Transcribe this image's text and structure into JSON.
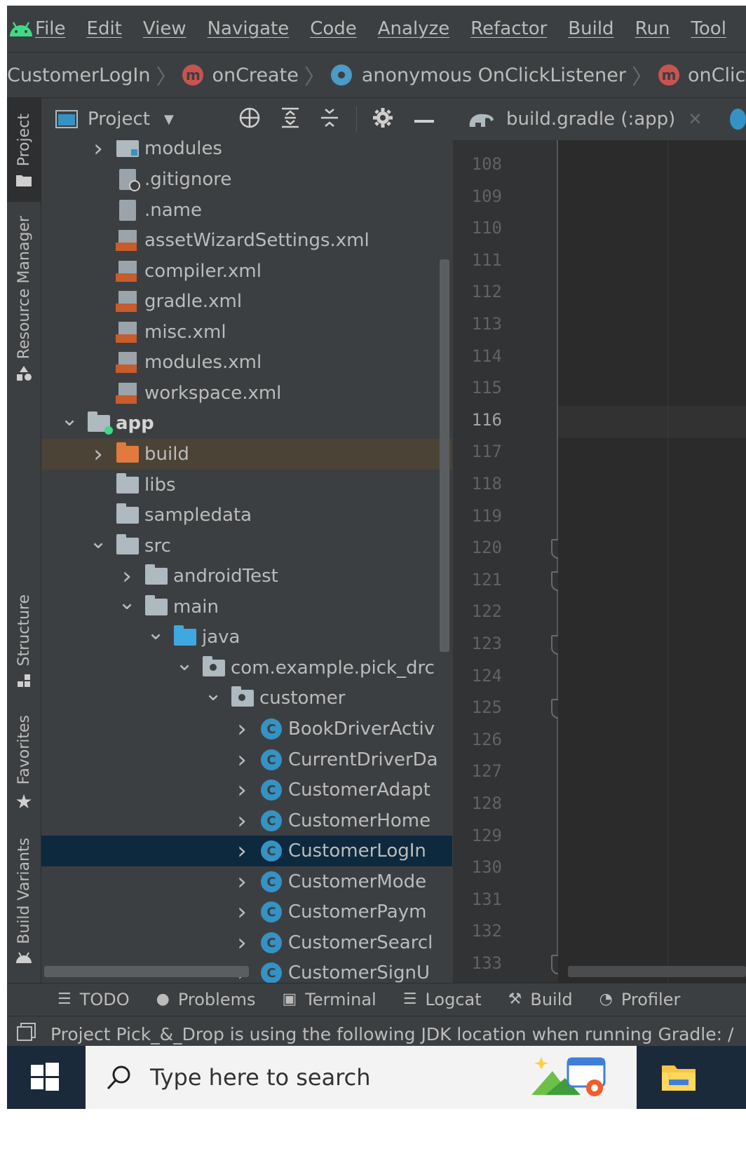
{
  "menu": [
    "File",
    "Edit",
    "View",
    "Navigate",
    "Code",
    "Analyze",
    "Refactor",
    "Build",
    "Run",
    "Tool"
  ],
  "breadcrumb": {
    "items": [
      {
        "label": "CustomerLogIn",
        "icon": ""
      },
      {
        "label": "onCreate",
        "icon": "method-icon"
      },
      {
        "label": "anonymous OnClickListener",
        "icon": "lambda-icon"
      },
      {
        "label": "onClick",
        "icon": "method-icon"
      }
    ]
  },
  "side_stripe": [
    "Project",
    "Resource Manager",
    "Structure",
    "Favorites",
    "Build Variants"
  ],
  "project_panel": {
    "title": "Project",
    "tree": [
      {
        "label": "modules",
        "depth": 2,
        "arrow": "right",
        "icon": "folder-modules"
      },
      {
        "label": ".gitignore",
        "depth": 2,
        "arrow": "",
        "icon": "gitignore"
      },
      {
        "label": ".name",
        "depth": 2,
        "arrow": "",
        "icon": "text"
      },
      {
        "label": "assetWizardSettings.xml",
        "depth": 2,
        "arrow": "",
        "icon": "xml"
      },
      {
        "label": "compiler.xml",
        "depth": 2,
        "arrow": "",
        "icon": "xml"
      },
      {
        "label": "gradle.xml",
        "depth": 2,
        "arrow": "",
        "icon": "xml"
      },
      {
        "label": "misc.xml",
        "depth": 2,
        "arrow": "",
        "icon": "xml"
      },
      {
        "label": "modules.xml",
        "depth": 2,
        "arrow": "",
        "icon": "xml"
      },
      {
        "label": "workspace.xml",
        "depth": 2,
        "arrow": "",
        "icon": "xml"
      },
      {
        "label": "app",
        "depth": 1,
        "arrow": "down",
        "icon": "folder-module",
        "bold": true
      },
      {
        "label": "build",
        "depth": 2,
        "arrow": "right",
        "icon": "folder-orange",
        "highlight": "dim"
      },
      {
        "label": "libs",
        "depth": 2,
        "arrow": "",
        "icon": "folder"
      },
      {
        "label": "sampledata",
        "depth": 2,
        "arrow": "",
        "icon": "folder"
      },
      {
        "label": "src",
        "depth": 2,
        "arrow": "down",
        "icon": "folder"
      },
      {
        "label": "androidTest",
        "depth": 3,
        "arrow": "right",
        "icon": "folder"
      },
      {
        "label": "main",
        "depth": 3,
        "arrow": "down",
        "icon": "folder"
      },
      {
        "label": "java",
        "depth": 4,
        "arrow": "down",
        "icon": "folder-blue"
      },
      {
        "label": "com.example.pick_drc",
        "depth": 5,
        "arrow": "down",
        "icon": "package"
      },
      {
        "label": "customer",
        "depth": 6,
        "arrow": "down",
        "icon": "package"
      },
      {
        "label": "BookDriverActiv",
        "depth": 7,
        "arrow": "right",
        "icon": "class"
      },
      {
        "label": "CurrentDriverDa",
        "depth": 7,
        "arrow": "right",
        "icon": "class"
      },
      {
        "label": "CustomerAdapt",
        "depth": 7,
        "arrow": "right",
        "icon": "class"
      },
      {
        "label": "CustomerHome",
        "depth": 7,
        "arrow": "right",
        "icon": "class"
      },
      {
        "label": "CustomerLogIn",
        "depth": 7,
        "arrow": "right",
        "icon": "class",
        "highlight": "selected"
      },
      {
        "label": "CustomerMode",
        "depth": 7,
        "arrow": "right",
        "icon": "class"
      },
      {
        "label": "CustomerPaym",
        "depth": 7,
        "arrow": "right",
        "icon": "class"
      },
      {
        "label": "CustomerSearcl",
        "depth": 7,
        "arrow": "right",
        "icon": "class"
      },
      {
        "label": "CustomerSignU",
        "depth": 7,
        "arrow": "right",
        "icon": "class"
      }
    ]
  },
  "editor": {
    "tab_label": "build.gradle (:app)",
    "current_line": "116",
    "lines": [
      "108",
      "109",
      "110",
      "111",
      "112",
      "113",
      "114",
      "115",
      "116",
      "117",
      "118",
      "119",
      "120",
      "121",
      "122",
      "123",
      "124",
      "125",
      "126",
      "127",
      "128",
      "129",
      "130",
      "131",
      "132",
      "133"
    ],
    "fold_lines": [
      "120",
      "121",
      "123",
      "125",
      "133"
    ]
  },
  "bottom_tools": [
    {
      "label": "TODO",
      "icon": "list-icon"
    },
    {
      "label": "Problems",
      "icon": "problems-icon"
    },
    {
      "label": "Terminal",
      "icon": "terminal-icon"
    },
    {
      "label": "Logcat",
      "icon": "logcat-icon"
    },
    {
      "label": "Build",
      "icon": "hammer-icon"
    },
    {
      "label": "Profiler",
      "icon": "gauge-icon"
    }
  ],
  "status_message": "Project Pick_&_Drop is using the following JDK location when running Gradle: /",
  "taskbar": {
    "search_placeholder": "Type here to search"
  }
}
